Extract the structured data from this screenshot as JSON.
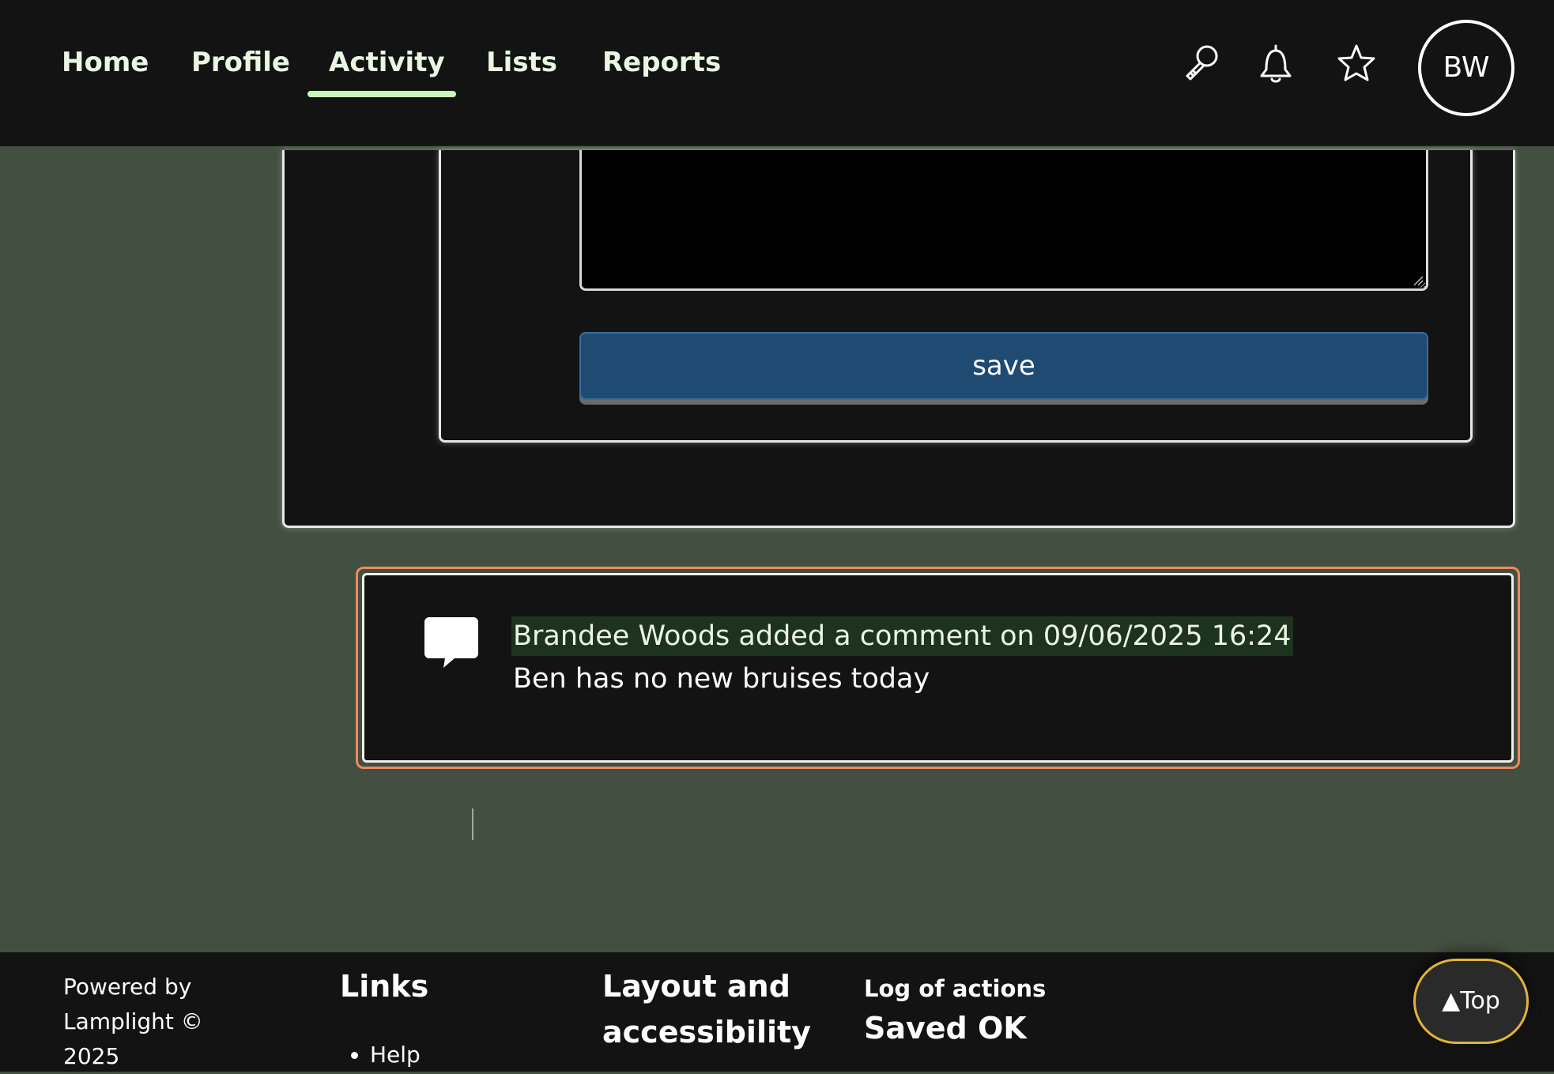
{
  "nav": {
    "items": [
      {
        "label": "Home"
      },
      {
        "label": "Profile"
      },
      {
        "label": "Activity",
        "active": true
      },
      {
        "label": "Lists"
      },
      {
        "label": "Reports"
      }
    ],
    "icons": [
      "search-icon",
      "bell-icon",
      "star-icon"
    ],
    "avatar_initials": "BW",
    "accent_color": "#c8f5bc"
  },
  "form": {
    "textarea_value": "",
    "save_label": "save",
    "save_color": "#1f4a72"
  },
  "activity": {
    "icon": "comment-icon",
    "heading": "Brandee Woods added a comment on 09/06/2025 16:24",
    "text": "Ben has no new bruises today",
    "highlight_color": "#f08a5d"
  },
  "footer": {
    "powered_by": "Powered by Lamplight © 2025",
    "links_heading": "Links",
    "links": [
      {
        "label": "Help"
      }
    ],
    "layout_heading": "Layout and accessibility",
    "log_label": "Log of actions",
    "log_status": "Saved OK",
    "top_button_label": "▲Top",
    "top_button_border_color": "#e3b23c"
  }
}
